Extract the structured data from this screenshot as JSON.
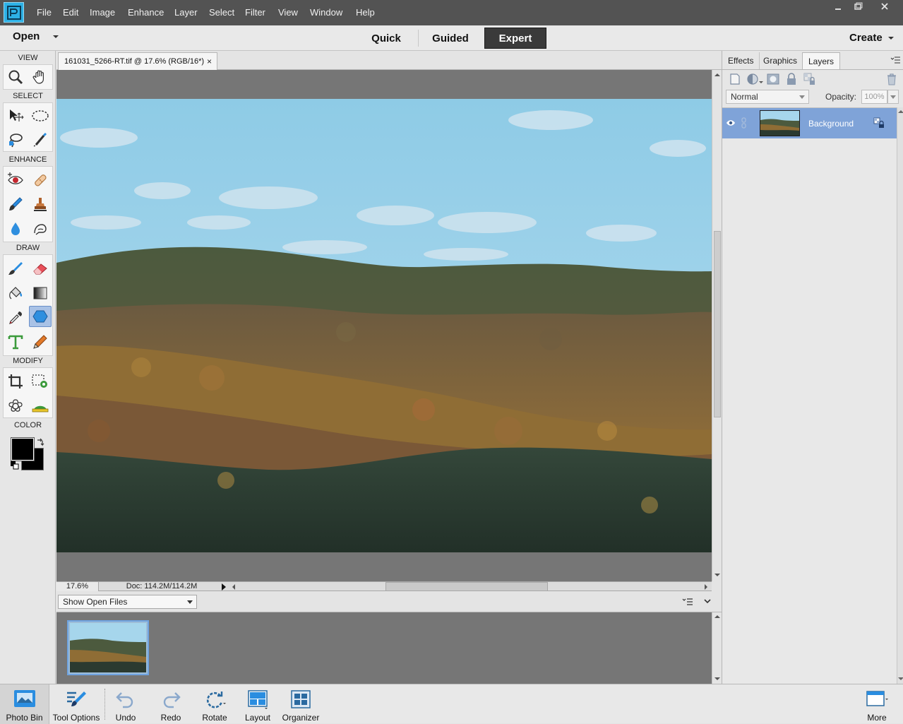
{
  "menubar": {
    "items": [
      "File",
      "Edit",
      "Image",
      "Enhance",
      "Layer",
      "Select",
      "Filter",
      "View",
      "Window",
      "Help"
    ]
  },
  "modebar": {
    "open_label": "Open",
    "tabs": [
      "Quick",
      "Guided",
      "Expert"
    ],
    "active_tab": "Expert",
    "create_label": "Create"
  },
  "toolbox": {
    "sections": [
      "VIEW",
      "SELECT",
      "ENHANCE",
      "DRAW",
      "MODIFY",
      "COLOR"
    ],
    "tools": [
      "zoom-tool-icon",
      "hand-tool-icon",
      "move-tool-icon",
      "elliptical-marquee-icon",
      "lasso-tool-icon",
      "quick-selection-icon",
      "red-eye-icon",
      "spot-healing-icon",
      "smart-brush-icon",
      "clone-stamp-icon",
      "blur-tool-icon",
      "smudge-tool-icon",
      "brush-tool-icon",
      "eraser-tool-icon",
      "paint-bucket-icon",
      "gradient-tool-icon",
      "eyedropper-icon",
      "custom-shape-icon",
      "type-tool-icon",
      "pencil-tool-icon",
      "crop-tool-icon",
      "recompose-tool-icon",
      "content-aware-move-icon",
      "straighten-tool-icon"
    ],
    "active_tool": "custom-shape-icon",
    "foreground_color": "#000000",
    "background_color": "#000000"
  },
  "document": {
    "tab_label": "161031_5266-RT.tif @ 17.6% (RGB/16*)",
    "close_symbol": "×",
    "zoom": "17.6%",
    "doc_size": "Doc: 114.2M/114.2M"
  },
  "photo_bin": {
    "select_value": "Show Open Files"
  },
  "right_panel": {
    "tabs": [
      "Effects",
      "Graphics",
      "Layers"
    ],
    "active_tab": "Layers",
    "blend_mode": "Normal",
    "opacity_label": "Opacity:",
    "opacity_value": "100%",
    "layers": [
      {
        "name": "Background",
        "visible": true
      }
    ],
    "selection_color": "#7fa3d8"
  },
  "bottombar": {
    "items": [
      "Photo Bin",
      "Tool Options",
      "Undo",
      "Redo",
      "Rotate",
      "Layout",
      "Organizer"
    ],
    "more_label": "More"
  },
  "colors": {
    "menubar_bg": "#535353",
    "canvas_bg": "#767676",
    "accent_blue": "#2db1e6"
  }
}
